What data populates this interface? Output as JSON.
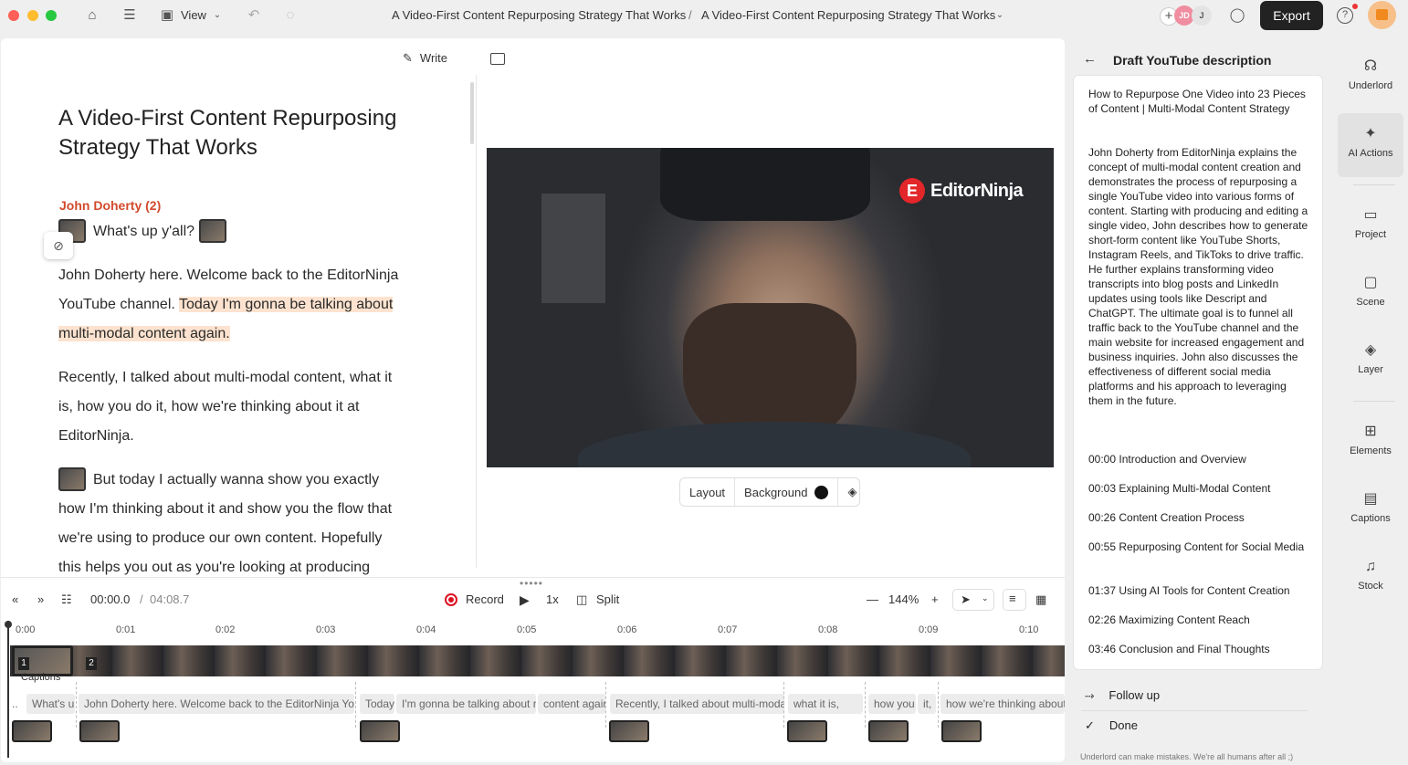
{
  "titlebar": {
    "view_label": "View",
    "project_title": "A Video-First Content Repurposing Strategy That Works",
    "separator": "/",
    "composition_title": "A Video-First Content Repurposing Strategy That Works",
    "avatar_1": "JD",
    "avatar_2": "J",
    "export_label": "Export"
  },
  "script": {
    "write_label": "Write",
    "doc_title": "A Video-First Content Repurposing Strategy That Works",
    "speaker": "John Doherty (2)",
    "line_1": "What's up y'all?",
    "para_1_a": "John Doherty here. Welcome back to the EditorNinja",
    "para_1_b": "YouTube channel.",
    "para_1_hl_a": "Today I'm gonna be talking about",
    "para_1_hl_b": "multi-modal content again.",
    "para_2_a": "Recently, I talked about multi-modal content, what it",
    "para_2_b": "is, how you do it, how we're thinking about it at",
    "para_2_c": "EditorNinja.",
    "para_3_a": "But today I actually wanna show you exactly",
    "para_3_b": "how I'm thinking about it and show you the flow that",
    "para_3_c": "we're using to produce our own content. Hopefully",
    "para_3_d": "this helps you out as you're looking at producing"
  },
  "preview": {
    "logo_text": "EditorNinja",
    "layout_label": "Layout",
    "background_label": "Background"
  },
  "transport": {
    "current_time": "00:00.0",
    "time_sep": "/",
    "total_time": "04:08.7",
    "record_label": "Record",
    "speed": "1x",
    "split_label": "Split",
    "zoom": "144%"
  },
  "timeline": {
    "ticks": [
      "0:00",
      "0:01",
      "0:02",
      "0:03",
      "0:04",
      "0:05",
      "0:06",
      "0:07",
      "0:08",
      "0:09",
      "0:10"
    ],
    "clip_1": "1",
    "clip_2": "2",
    "captions_label": "Captions",
    "caption_chips": [
      "..",
      "What's u",
      "John Doherty here. Welcome back to the EditorNinja You",
      "Today",
      "I'm gonna be talking about r",
      "content agair",
      "Recently, I talked about multi-moda",
      "what it is,",
      "how you",
      "it,",
      "how we're thinking about it at"
    ]
  },
  "ai_panel": {
    "heading": "Draft YouTube description",
    "title_text": "How to Repurpose One Video into 23 Pieces of Content | Multi-Modal Content Strategy",
    "body_text": "John Doherty from EditorNinja explains the concept of multi-modal content creation and demonstrates the process of repurposing a single YouTube video into various forms of content. Starting with producing and editing a single video, John describes how to generate short-form content like YouTube Shorts, Instagram Reels, and TikToks to drive traffic. He further explains transforming video transcripts into blog posts and LinkedIn updates using tools like Descript and ChatGPT. The ultimate goal is to funnel all traffic back to the YouTube channel and the main website for increased engagement and business inquiries. John also discusses the effectiveness of different social media platforms and his approach to leveraging them in the future.",
    "chapters": [
      "00:00 Introduction and Overview",
      "00:03 Explaining Multi-Modal Content",
      "00:26 Content Creation Process",
      "00:55 Repurposing Content for Social Media",
      "01:37 Using AI Tools for Content Creation",
      "02:26 Maximizing Content Reach",
      "03:46 Conclusion and Final Thoughts"
    ],
    "follow_up_label": "Follow up",
    "done_label": "Done",
    "disclaimer": "Underlord can make mistakes. We're all humans after all ;)"
  },
  "rail": {
    "items": [
      "Underlord",
      "AI Actions",
      "Project",
      "Scene",
      "Layer",
      "Elements",
      "Captions",
      "Stock"
    ],
    "active": "AI Actions"
  },
  "colors": {
    "speaker": "#d24a2c",
    "highlight": "#fde3cf",
    "record": "#dd1122",
    "logo_red": "#e3262a"
  }
}
